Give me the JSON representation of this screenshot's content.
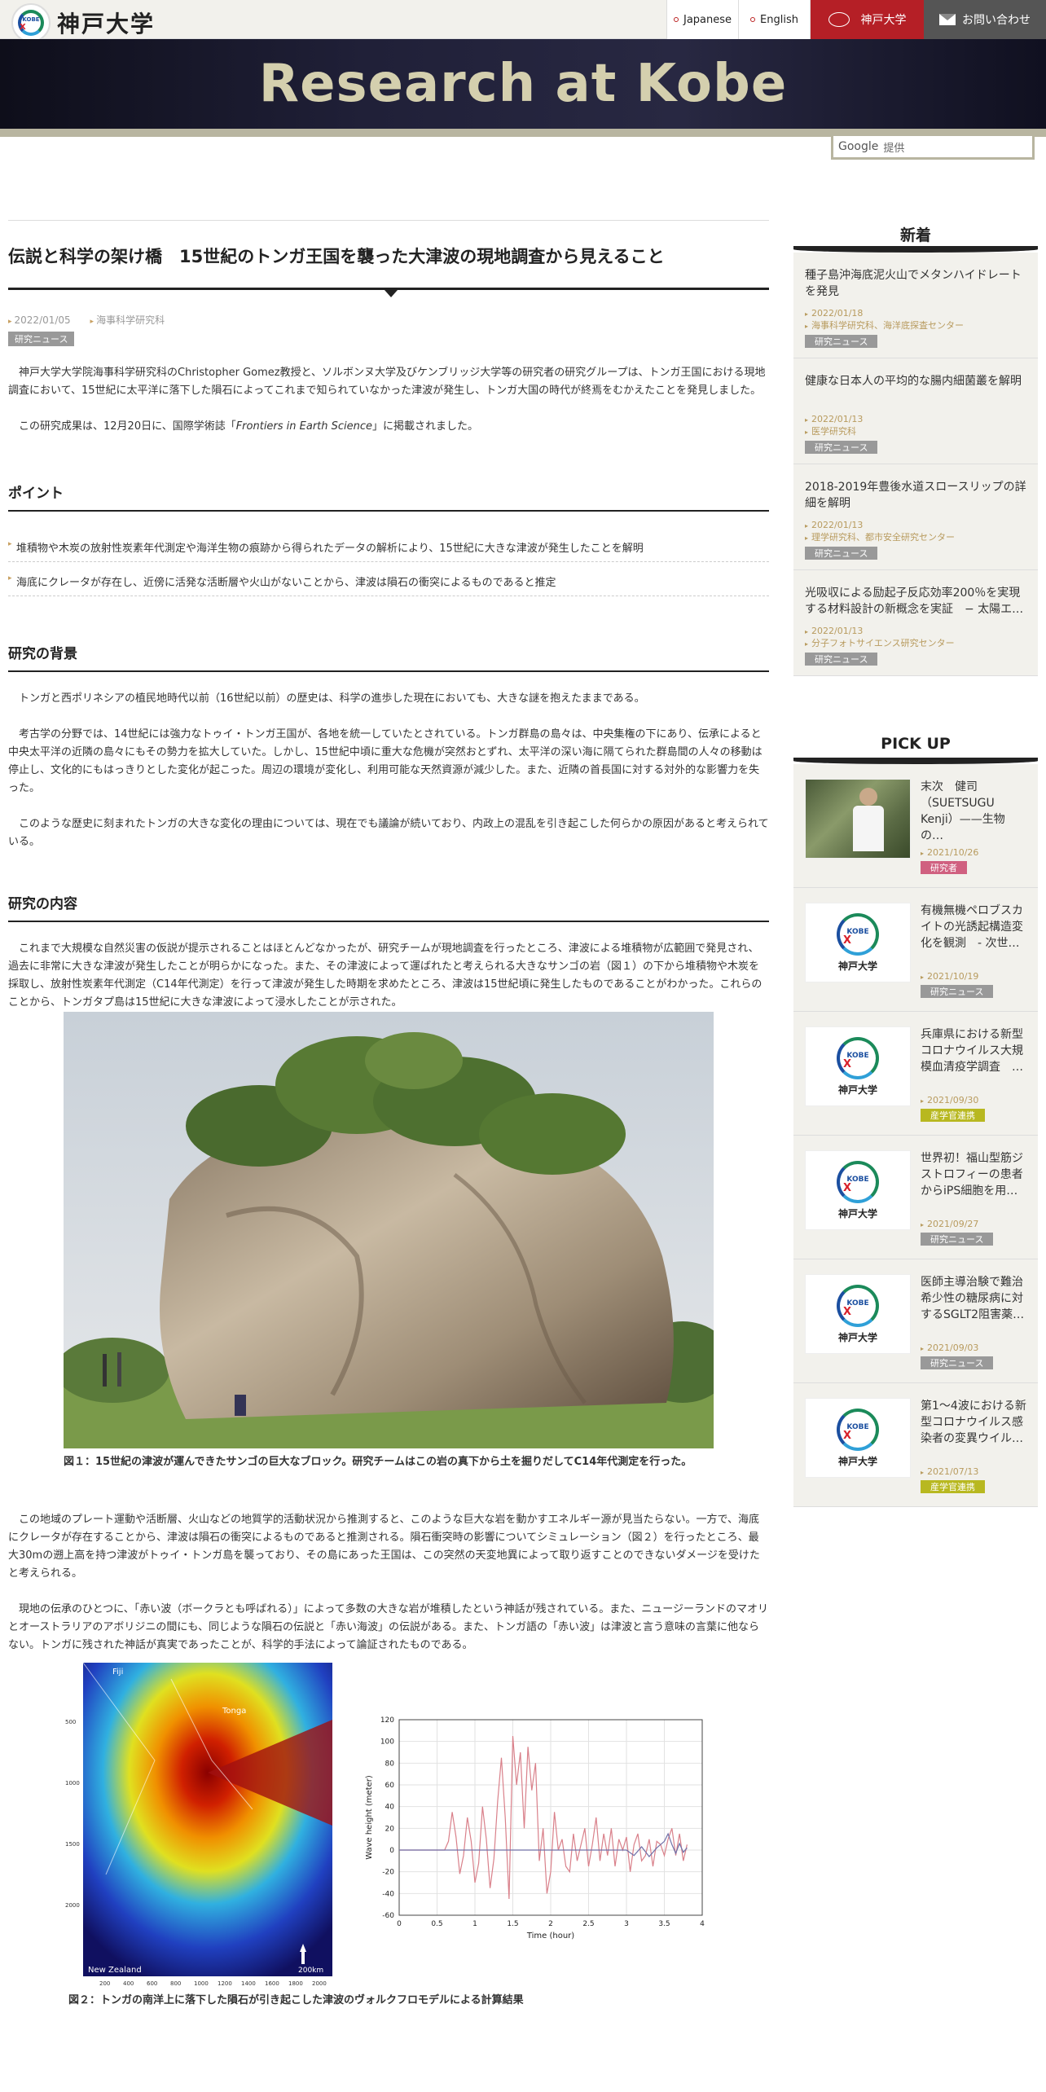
{
  "header": {
    "logo_text": "神戸大学",
    "logo_mark_text": "KOBE",
    "nav": {
      "japanese": "Japanese",
      "english": "English",
      "kobe_univ": "神戸大学",
      "contact": "お問い合わせ"
    },
    "banner_title": "Research at Kobe",
    "search_brand": "Google",
    "search_label": "提供"
  },
  "article": {
    "title": "伝説と科学の架け橋　15世紀のトンガ王国を襲った大津波の現地調査から見えること",
    "date": "2022/01/05",
    "department": "海事科学研究科",
    "tag": "研究ニュース",
    "intro": "神戸大学大学院海事科学研究科のChristopher Gomez教授と、ソルボンヌ大学及びケンブリッジ大学等の研究者の研究グループは、トンガ王国における現地調査において、15世紀に太平洋に落下した隕石によってこれまで知られていなかった津波が発生し、トンガ大国の時代が終焉をむかえたことを発見しました。",
    "published_pre": "この研究成果は、12月20日に、国際学術誌「",
    "published_journal": "Frontiers in Earth Science",
    "published_post": "」に掲載されました。",
    "points_heading": "ポイント",
    "points": [
      "堆積物や木炭の放射性炭素年代測定や海洋生物の痕跡から得られたデータの解析により、15世紀に大きな津波が発生したことを解明",
      "海底にクレータが存在し、近傍に活発な活断層や火山がないことから、津波は隕石の衝突によるものであると推定"
    ],
    "background_heading": "研究の背景",
    "background": [
      "トンガと西ポリネシアの植民地時代以前（16世紀以前）の歴史は、科学の進歩した現在においても、大きな謎を抱えたままである。",
      "考古学の分野では、14世紀には強力なトゥイ・トンガ王国が、各地を統一していたとされている。トンガ群島の島々は、中央集権の下にあり、伝承によると中央太平洋の近隣の島々にもその勢力を拡大していた。しかし、15世紀中頃に重大な危機が突然おとずれ、太平洋の深い海に隔てられた群島間の人々の移動は停止し、文化的にもはっきりとした変化が起こった。周辺の環境が変化し、利用可能な天然資源が減少した。また、近隣の首長国に対する対外的な影響力を失った。",
      "このような歴史に刻まれたトンガの大きな変化の理由については、現在でも議論が続いており、内政上の混乱を引き起こした何らかの原因があると考えられている。"
    ],
    "content_heading": "研究の内容",
    "content_1": "これまで大規模な自然災害の仮説が提示されることはほとんどなかったが、研究チームが現地調査を行ったところ、津波による堆積物が広範囲で発見され、過去に非常に大きな津波が発生したことが明らかになった。また、その津波によって運ばれたと考えられる大きなサンゴの岩（図１）の下から堆積物や木炭を採取し、放射性炭素年代測定（C14年代測定）を行って津波が発生した時期を求めたところ、津波は15世紀頃に発生したものであることがわかった。これらのことから、トンガタプ島は15世紀に大きな津波によって浸水したことが示された。",
    "figure1_caption": "図１：15世紀の津波が運んできたサンゴの巨大なブロック。研究チームはこの岩の真下から土を掘りだしてC14年代測定を行った。",
    "content_2": "この地域のプレート運動や活断層、火山などの地質学的活動状況から推測すると、このような巨大な岩を動かすエネルギー源が見当たらない。一方で、海底にクレータが存在することから、津波は隕石の衝突によるものであると推測される。隕石衝突時の影響についてシミュレーション（図２）を行ったところ、最大30mの遡上高を持つ津波がトゥイ・トンガ島を襲っており、その島にあった王国は、この突然の天変地異によって取り返すことのできないダメージを受けたと考えられる。",
    "content_3": "現地の伝承のひとつに、「赤い波（ボークラとも呼ばれる）」によって多数の大きな岩が堆積したという神話が残されている。また、ニュージーランドのマオリとオーストラリアのアボリジニの間にも、同じような隕石の伝説と「赤い海波」の伝説がある。また、トンガ語の「赤い波」は津波と言う意味の言葉に他ならない。トンガに残された神話が真実であったことが、科学的手法によって論証されたものである。",
    "figure2_caption": "図２：トンガの南洋上に落下した隕石が引き起こした津波のヴォルクフロモデルによる計算結果",
    "map_labels": {
      "fiji": "Fiji",
      "tonga": "Tonga",
      "nz": "New Zealand",
      "scale": "200km",
      "y_ticks": [
        "500",
        "1000",
        "1500",
        "2000"
      ],
      "x_ticks": [
        "200",
        "400",
        "600",
        "800",
        "1000",
        "1200",
        "1400",
        "1600",
        "1800",
        "2000"
      ]
    }
  },
  "chart_data": {
    "type": "line",
    "title": "",
    "xlabel": "Time (hour)",
    "ylabel": "Wave height (meter)",
    "xlim": [
      0,
      4
    ],
    "ylim": [
      -60,
      120
    ],
    "xticks": [
      "0",
      "0.5",
      "1",
      "1.5",
      "2",
      "2.5",
      "3",
      "3.5",
      "4"
    ],
    "yticks": [
      "120",
      "100",
      "80",
      "60",
      "40",
      "20",
      "0",
      "-20",
      "-40",
      "-60"
    ],
    "grid": true,
    "series": [
      {
        "color": "#d9808a",
        "x": [
          0,
          0.6,
          0.65,
          0.7,
          0.75,
          0.8,
          0.85,
          0.9,
          0.95,
          1.0,
          1.05,
          1.1,
          1.15,
          1.2,
          1.25,
          1.3,
          1.35,
          1.4,
          1.45,
          1.5,
          1.55,
          1.6,
          1.65,
          1.7,
          1.75,
          1.8,
          1.85,
          1.9,
          1.95,
          2.0,
          2.05,
          2.1,
          2.15,
          2.2,
          2.25,
          2.3,
          2.35,
          2.4,
          2.45,
          2.5,
          2.55,
          2.6,
          2.65,
          2.7,
          2.75,
          2.8,
          2.85,
          2.9,
          2.95,
          3.0,
          3.05,
          3.1,
          3.15,
          3.2,
          3.25,
          3.3,
          3.35,
          3.4,
          3.45,
          3.5,
          3.55,
          3.6,
          3.65,
          3.7,
          3.75,
          3.8
        ],
        "y": [
          0,
          0,
          8,
          35,
          12,
          -22,
          -5,
          30,
          8,
          -30,
          -12,
          40,
          10,
          -35,
          -8,
          45,
          85,
          30,
          -45,
          105,
          60,
          90,
          20,
          95,
          55,
          80,
          -10,
          20,
          -40,
          -20,
          35,
          0,
          10,
          -15,
          -20,
          15,
          -10,
          5,
          20,
          -15,
          5,
          30,
          -10,
          15,
          -5,
          20,
          -15,
          10,
          0,
          12,
          -20,
          5,
          15,
          -10,
          -5,
          10,
          -15,
          8,
          5,
          -5,
          10,
          20,
          -5,
          15,
          -10,
          5
        ]
      },
      {
        "color": "#7070a8",
        "x": [
          0,
          3.0,
          3.1,
          3.2,
          3.3,
          3.4,
          3.5,
          3.55,
          3.6,
          3.65,
          3.7,
          3.75,
          3.8
        ],
        "y": [
          0,
          0,
          -5,
          3,
          -6,
          2,
          8,
          15,
          5,
          -3,
          6,
          -2,
          2
        ]
      }
    ]
  },
  "sidebar": {
    "new_heading": "新着",
    "news": [
      {
        "title": "種子島沖海底泥火山でメタンハイドレートを発見",
        "date": "2022/01/18",
        "dept": "海事科学研究科、海洋底探査センター",
        "tag": "研究ニュース"
      },
      {
        "title": "健康な日本人の平均的な腸内細菌叢を解明",
        "date": "2022/01/13",
        "dept": "医学研究科",
        "tag": "研究ニュース"
      },
      {
        "title": "2018-2019年豊後水道スロースリップの詳細を解明",
        "date": "2022/01/13",
        "dept": "理学研究科、都市安全研究センター",
        "tag": "研究ニュース"
      },
      {
        "title": "光吸収による励起子反応効率200％を実現する材料設計の新概念を実証　− 太陽エ…",
        "date": "2022/01/13",
        "dept": "分子フォトサイエンス研究センター",
        "tag": "研究ニュース"
      }
    ],
    "pickup_heading": "PICK UP",
    "thumb_logo_text": "KOBE",
    "thumb_name": "神戸大学",
    "pickup": [
      {
        "title": "末次　健司（SUETSUGU Kenji）——生物の…",
        "date": "2021/10/26",
        "tag": "研究者",
        "tag_color": "#d06080",
        "thumb": "photo"
      },
      {
        "title": "有機無機ペロブスカイトの光誘起構造変化を観測　- 次世…",
        "date": "2021/10/19",
        "tag": "研究ニュース",
        "tag_color": "#999999",
        "thumb": "logo"
      },
      {
        "title": "兵庫県における新型コロナウイルス大規模血清疫学調査　…",
        "date": "2021/09/30",
        "tag": "産学官連携",
        "tag_color": "#b8b820",
        "thumb": "logo"
      },
      {
        "title": "世界初！福山型筋ジストロフィーの患者からiPS細胞を用…",
        "date": "2021/09/27",
        "tag": "研究ニュース",
        "tag_color": "#999999",
        "thumb": "logo"
      },
      {
        "title": "医師主導治験で難治希少性の糖尿病に対するSGLT2阻害薬…",
        "date": "2021/09/03",
        "tag": "研究ニュース",
        "tag_color": "#999999",
        "thumb": "logo"
      },
      {
        "title": "第1～4波における新型コロナウイルス感染者の変異ウイル…",
        "date": "2021/07/13",
        "tag": "産学官連携",
        "tag_color": "#b8b820",
        "thumb": "logo"
      }
    ]
  }
}
